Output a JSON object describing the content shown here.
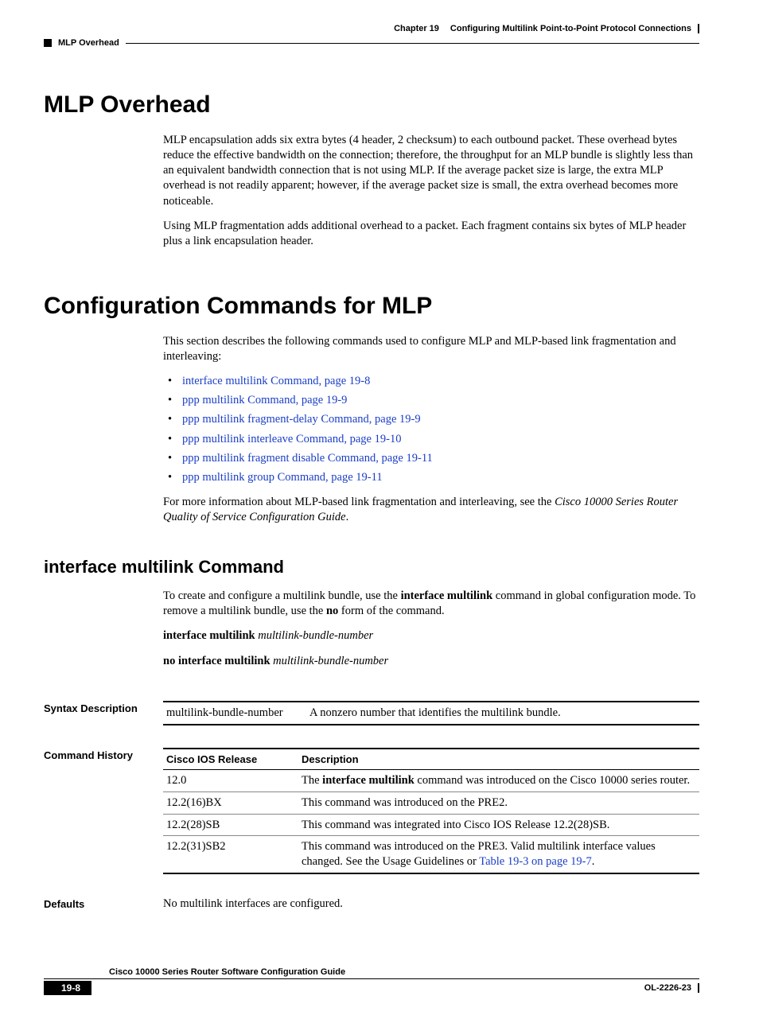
{
  "header": {
    "chapter": "Chapter 19",
    "title": "Configuring Multilink Point-to-Point Protocol Connections",
    "running": "MLP Overhead"
  },
  "section1": {
    "heading": "MLP Overhead",
    "p1": "MLP encapsulation adds six extra bytes (4 header, 2 checksum) to each outbound packet. These overhead bytes reduce the effective bandwidth on the connection; therefore, the throughput for an MLP bundle is slightly less than an equivalent bandwidth connection that is not using MLP. If the average packet size is large, the extra MLP overhead is not readily apparent; however, if the average packet size is small, the extra overhead becomes more noticeable.",
    "p2": "Using MLP fragmentation adds additional overhead to a packet. Each fragment contains six bytes of MLP header plus a link encapsulation header."
  },
  "section2": {
    "heading": "Configuration Commands for MLP",
    "intro": "This section describes the following commands used to configure MLP and MLP-based link fragmentation and interleaving:",
    "links": [
      "interface multilink Command, page 19-8",
      "ppp multilink Command, page 19-9",
      "ppp multilink fragment-delay Command, page 19-9",
      "ppp multilink interleave Command, page 19-10",
      "ppp multilink fragment disable Command, page 19-11",
      "ppp multilink group Command, page 19-11"
    ],
    "outro_pre": "For more information about MLP-based link fragmentation and interleaving, see the ",
    "outro_em": "Cisco 10000 Series Router Quality of Service Configuration Guide",
    "outro_post": "."
  },
  "section3": {
    "heading": "interface multilink Command",
    "p1_pre": "To create and configure a multilink bundle, use the ",
    "p1_b1": "interface multilink",
    "p1_mid": " command in global configuration mode. To remove a multilink bundle, use the ",
    "p1_b2": "no",
    "p1_post": " form of the command.",
    "syntax1_cmd": "interface multilink",
    "syntax1_arg": "multilink-bundle-number",
    "syntax2_cmd": "no interface multilink",
    "syntax2_arg": "multilink-bundle-number"
  },
  "syntax_desc": {
    "label": "Syntax Description",
    "param": "multilink-bundle-number",
    "text": "A nonzero number that identifies the multilink bundle."
  },
  "history": {
    "label": "Command History",
    "col1": "Cisco IOS Release",
    "col2": "Description",
    "rows": [
      {
        "rel": "12.0",
        "desc_pre": "The ",
        "desc_b": "interface multilink",
        "desc_post": " command was introduced on the Cisco 10000 series router."
      },
      {
        "rel": "12.2(16)BX",
        "desc_pre": "",
        "desc_b": "",
        "desc_post": "This command was introduced on the PRE2."
      },
      {
        "rel": "12.2(28)SB",
        "desc_pre": "",
        "desc_b": "",
        "desc_post": "This command was integrated into Cisco IOS Release 12.2(28)SB."
      },
      {
        "rel": "12.2(31)SB2",
        "desc_pre": "",
        "desc_b": "",
        "desc_post": "This command was introduced on the PRE3. Valid multilink interface values changed. See the Usage Guidelines or ",
        "link": "Table 19-3 on page 19-7",
        "tail": "."
      }
    ]
  },
  "defaults": {
    "label": "Defaults",
    "text": "No multilink interfaces are configured."
  },
  "footer": {
    "guide": "Cisco 10000 Series Router Software Configuration Guide",
    "page": "19-8",
    "docid": "OL-2226-23"
  }
}
